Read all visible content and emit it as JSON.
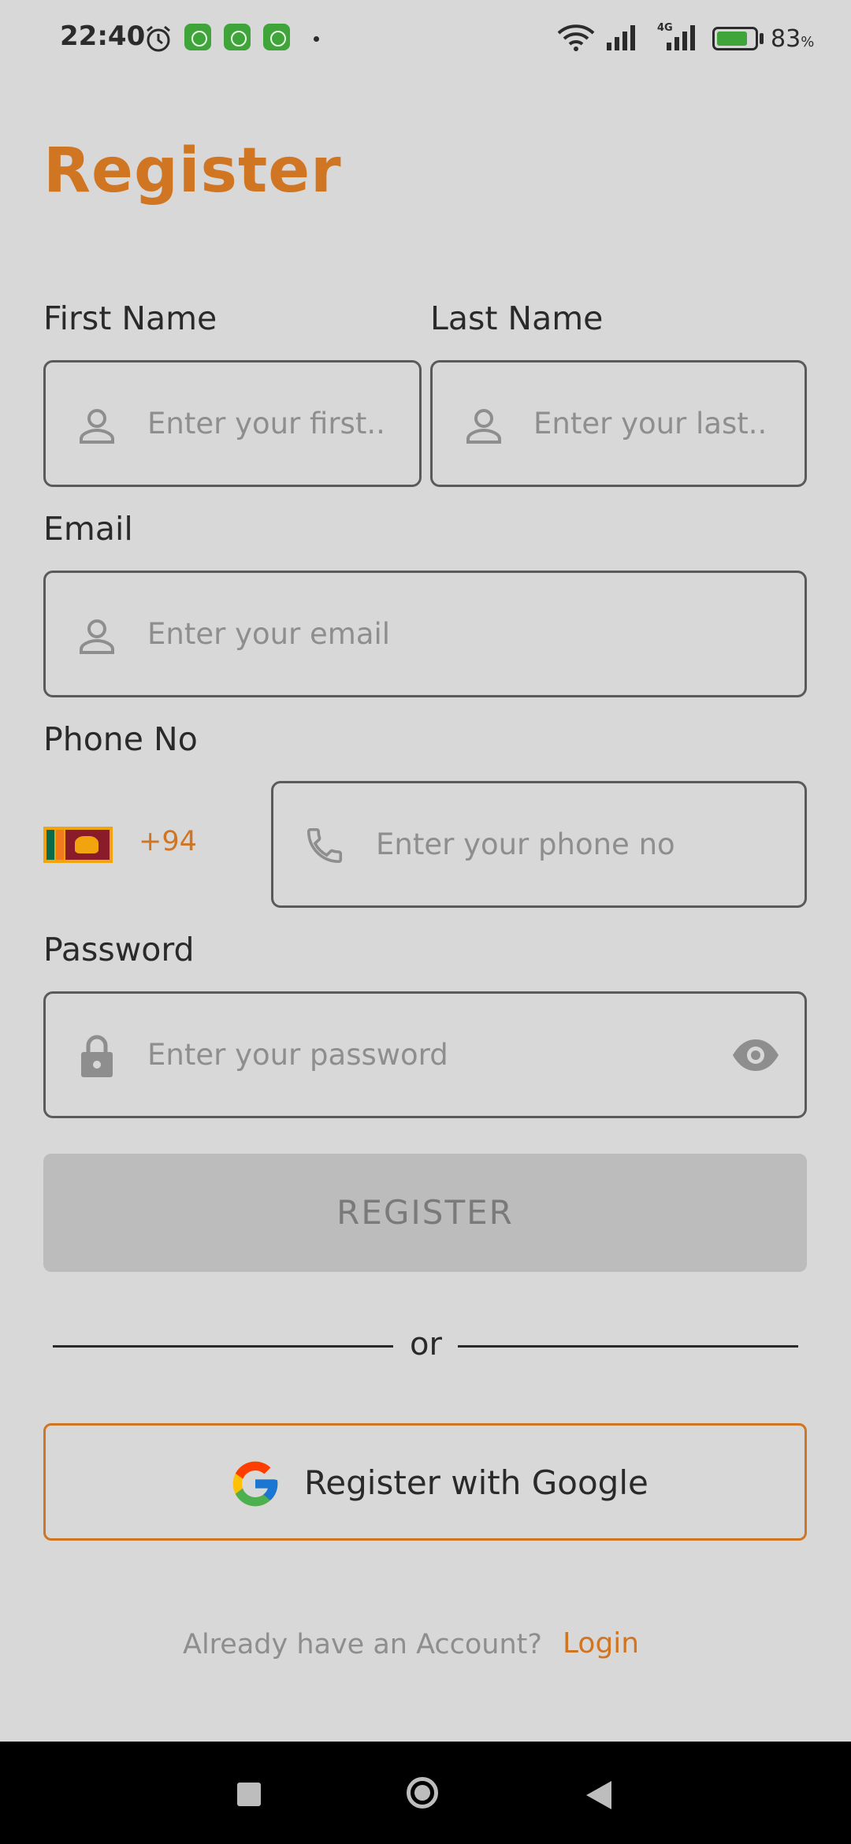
{
  "status_bar": {
    "time": "22:40",
    "network_label": "4G",
    "battery_percent": "83",
    "battery_percent_sign": "%",
    "battery_level": 0.83,
    "icons": [
      "alarm-icon",
      "app-notification-icon",
      "app-notification-icon",
      "app-notification-icon",
      "wifi-icon",
      "signal-icon",
      "signal-icon",
      "battery-charging-icon"
    ]
  },
  "page": {
    "title": "Register"
  },
  "form": {
    "first_name": {
      "label": "First Name",
      "placeholder": "Enter your first...",
      "icon": "person-icon"
    },
    "last_name": {
      "label": "Last Name",
      "placeholder": "Enter your last...",
      "icon": "person-icon"
    },
    "email": {
      "label": "Email",
      "placeholder": "Enter your email",
      "icon": "person-icon"
    },
    "phone": {
      "label": "Phone No",
      "country_code": "+94",
      "country_flag": "sri-lanka-flag-icon",
      "placeholder": "Enter your phone no",
      "icon": "phone-icon"
    },
    "password": {
      "label": "Password",
      "placeholder": "Enter your password",
      "icon": "lock-icon",
      "toggle_icon": "eye-icon"
    }
  },
  "actions": {
    "register_label": "REGISTER",
    "divider_text": "or",
    "google_label": "Register with Google",
    "google_icon": "google-logo-icon"
  },
  "footer": {
    "prompt": "Already have an Account?",
    "login_label": "Login"
  },
  "colors": {
    "accent": "#d07522",
    "background": "#d8d8d8",
    "button_disabled": "#bcbcbc"
  },
  "nav_bar": {
    "icons": [
      "recents-icon",
      "home-icon",
      "back-icon"
    ]
  }
}
